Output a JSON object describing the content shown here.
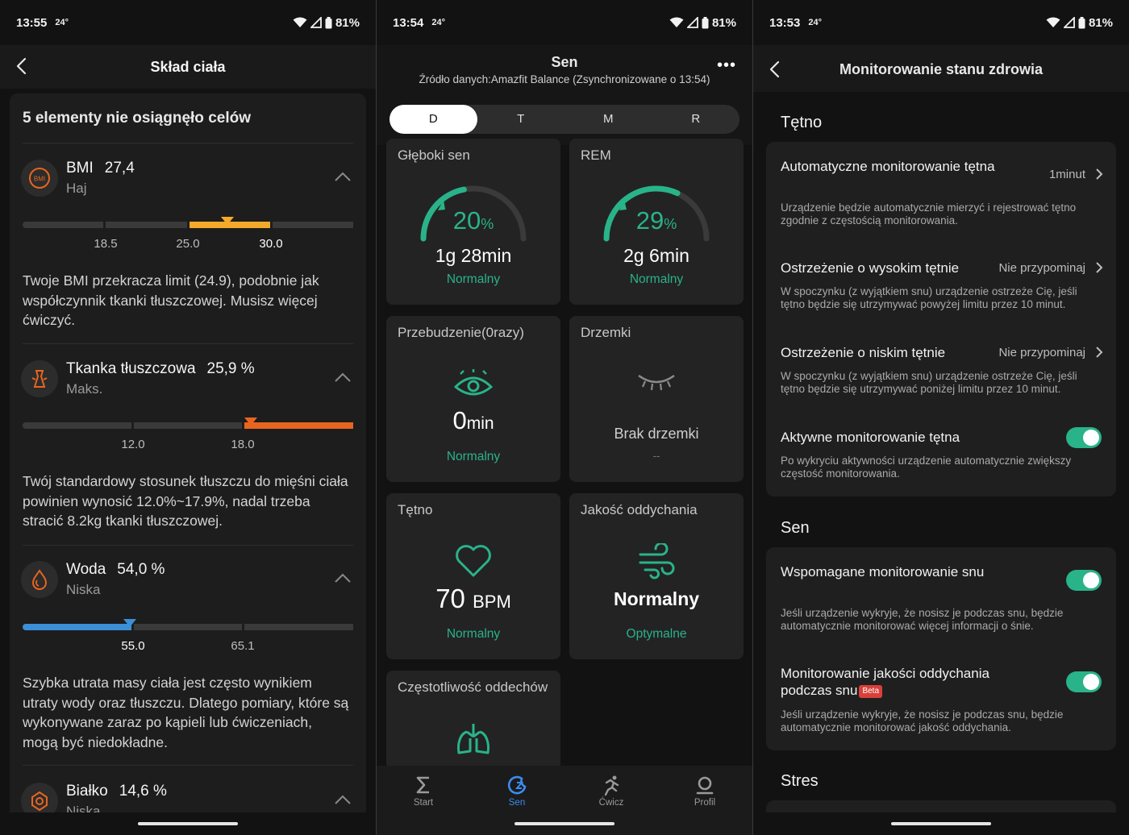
{
  "screen1": {
    "status": {
      "time": "13:55",
      "temp": "24°",
      "battery": "81%"
    },
    "title": "Skład ciała",
    "card_title": "5 elementy nie osiągnęło celów",
    "metrics": [
      {
        "name": "BMI",
        "value": "27,4",
        "status": "Haj",
        "icon": "bmi-icon",
        "ticks": [
          "18.5",
          "25.0",
          "30.0"
        ],
        "marker_fraction": 0.62,
        "color": "#f4a92a",
        "description": "Twoje BMI przekracza limit (24.9), podobnie jak współczynnik tkanki tłuszczowej. Musisz więcej ćwiczyć."
      },
      {
        "name": "Tkanka tłuszczowa",
        "value": "25,9 %",
        "status": "Maks.",
        "icon": "body-fat-icon",
        "ticks": [
          "12.0",
          "18.0"
        ],
        "marker_fraction": 0.71,
        "color": "#e8651f",
        "description": "Twój standardowy stosunek tłuszczu do mięśni ciała powinien wynosić 12.0%~17.9%, nadal trzeba stracić 8.2kg tkanki tłuszczowej."
      },
      {
        "name": "Woda",
        "value": "54,0 %",
        "status": "Niska",
        "icon": "water-drop-icon",
        "ticks": [
          "55.0",
          "65.1"
        ],
        "marker_fraction": 0.32,
        "color": "#3b8fd6",
        "description": "Szybka utrata masy ciała jest często wynikiem utraty wody oraz tłuszczu. Dlatego pomiary, które są wykonywane zaraz po kąpieli lub ćwiczeniach, mogą być niedokładne."
      },
      {
        "name": "Białko",
        "value": "14,6 %",
        "status": "Niska",
        "icon": "protein-icon"
      }
    ]
  },
  "screen2": {
    "status": {
      "time": "13:54",
      "temp": "24°",
      "battery": "81%"
    },
    "title": "Sen",
    "subtitle": "Źródło danych:Amazfit Balance (Zsynchronizowane o 13:54)",
    "tabs": [
      "D",
      "T",
      "M",
      "R"
    ],
    "selected_tab": "D",
    "tiles": {
      "deep": {
        "title": "Głęboki sen",
        "percent": "20",
        "percent_unit": "%",
        "duration": "1g 28min",
        "status": "Normalny",
        "fraction": 0.2
      },
      "rem": {
        "title": "REM",
        "percent": "29",
        "percent_unit": "%",
        "duration": "2g 6min",
        "status": "Normalny",
        "fraction": 0.29
      },
      "awake": {
        "title": "Przebudzenie(0razy)",
        "value": "0",
        "unit": "min",
        "status": "Normalny"
      },
      "naps": {
        "title": "Drzemki",
        "value": "Brak drzemki",
        "status": "--"
      },
      "heart": {
        "title": "Tętno",
        "value": "70",
        "unit": "BPM",
        "status": "Normalny"
      },
      "breathing": {
        "title": "Jakość oddychania",
        "value": "Normalny",
        "status": "Optymalne"
      },
      "resp_rate": {
        "title": "Częstotliwość oddechów"
      }
    },
    "nav": [
      {
        "label": "Start",
        "icon": "sigma-icon"
      },
      {
        "label": "Sen",
        "icon": "sleep-moon-icon",
        "active": true
      },
      {
        "label": "Ćwicz",
        "icon": "running-icon"
      },
      {
        "label": "Profil",
        "icon": "profile-icon"
      }
    ]
  },
  "screen3": {
    "status": {
      "time": "13:53",
      "temp": "24°",
      "battery": "81%"
    },
    "title": "Monitorowanie stanu zdrowia",
    "sections": {
      "heart": {
        "title": "Tętno",
        "items": [
          {
            "title": "Automatyczne monitorowanie tętna",
            "value": "1minut",
            "description": "Urządzenie będzie automatycznie mierzyć i rejestrować tętno zgodnie z częstością monitorowania."
          },
          {
            "title": "Ostrzeżenie o wysokim tętnie",
            "value": "Nie przypominaj",
            "description": "W spoczynku (z wyjątkiem snu) urządzenie ostrzeże Cię, jeśli tętno będzie się utrzymywać powyżej limitu przez 10 minut."
          },
          {
            "title": "Ostrzeżenie o niskim tętnie",
            "value": "Nie przypominaj",
            "description": "W spoczynku (z wyjątkiem snu) urządzenie ostrzeże Cię, jeśli tętno będzie się utrzymywać poniżej limitu przez 10 minut."
          },
          {
            "title": "Aktywne monitorowanie tętna",
            "toggle": true,
            "description": "Po wykryciu aktywności urządzenie automatycznie zwiększy częstość monitorowania."
          }
        ]
      },
      "sleep": {
        "title": "Sen",
        "items": [
          {
            "title": "Wspomagane monitorowanie snu",
            "toggle": true,
            "description": "Jeśli urządzenie wykryje, że nosisz je podczas snu, będzie automatycznie monitorować więcej informacji o śnie."
          },
          {
            "title": "Monitorowanie jakości oddychania podczas snu",
            "badge": "Beta",
            "toggle": true,
            "description": "Jeśli urządzenie wykryje, że nosisz je podczas snu, będzie automatycznie monitorować jakość oddychania."
          }
        ]
      },
      "stress": {
        "title": "Stres"
      }
    }
  },
  "colors": {
    "accent_green": "#29b389",
    "accent_blue": "#3a8cf0",
    "bmi_orange": "#f4a92a",
    "fat_orange": "#e8651f",
    "water_blue": "#3b8fd6"
  }
}
